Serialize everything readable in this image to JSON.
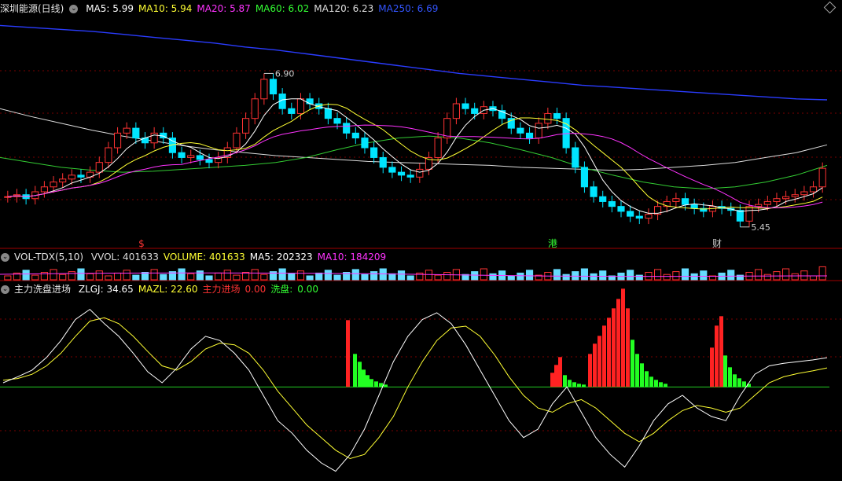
{
  "main": {
    "title": "深圳能源(日线)",
    "ma": [
      {
        "label": "MA5: 5.99",
        "color": "#ffffff"
      },
      {
        "label": "MA10: 5.94",
        "color": "#ffff33"
      },
      {
        "label": "MA20: 5.87",
        "color": "#ff33ff"
      },
      {
        "label": "MA60: 6.02",
        "color": "#33ff33"
      },
      {
        "label": "MA120: 6.23",
        "color": "#dddddd"
      },
      {
        "label": "MA250: 6.69",
        "color": "#3355ff"
      }
    ],
    "annotations": {
      "high": "6.90",
      "low": "5.45"
    },
    "markers": [
      "$",
      "港",
      "财"
    ]
  },
  "volume": {
    "title": "VOL-TDX(5,10)",
    "items": [
      {
        "label": "VVOL: 401633",
        "color": "#dddddd"
      },
      {
        "label": "VOLUME: 401633",
        "color": "#ffff33"
      },
      {
        "label": "MA5: 202323",
        "color": "#ffffff"
      },
      {
        "label": "MA10: 184209",
        "color": "#ff33ff"
      }
    ]
  },
  "indicator": {
    "title": "主力洗盘进场",
    "items": [
      {
        "label": "ZLGJ: 34.65",
        "color": "#ffffff"
      },
      {
        "label": "MAZL: 22.60",
        "color": "#ffff33"
      },
      {
        "label": "主力进场",
        "color": "#ff3333"
      },
      {
        "label": "0.00",
        "color": "#ff3333"
      },
      {
        "label": "洗盘:",
        "color": "#33ff33"
      },
      {
        "label": "0.00",
        "color": "#33ff33"
      }
    ]
  },
  "chart_data": {
    "type": "line",
    "candles_close": [
      5.7,
      5.72,
      5.68,
      5.75,
      5.8,
      5.85,
      5.88,
      5.92,
      5.9,
      5.95,
      6.05,
      6.2,
      6.35,
      6.4,
      6.3,
      6.25,
      6.35,
      6.3,
      6.15,
      6.1,
      6.12,
      6.08,
      6.05,
      6.1,
      6.2,
      6.35,
      6.5,
      6.7,
      6.9,
      6.75,
      6.6,
      6.55,
      6.7,
      6.65,
      6.6,
      6.5,
      6.45,
      6.35,
      6.3,
      6.2,
      6.1,
      6.0,
      5.95,
      5.92,
      5.9,
      5.98,
      6.1,
      6.3,
      6.5,
      6.65,
      6.6,
      6.55,
      6.62,
      6.58,
      6.5,
      6.4,
      6.35,
      6.3,
      6.45,
      6.55,
      6.5,
      6.2,
      6.0,
      5.8,
      5.7,
      5.65,
      5.6,
      5.55,
      5.5,
      5.48,
      5.52,
      5.6,
      5.65,
      5.68,
      5.62,
      5.58,
      5.55,
      5.6,
      5.58,
      5.56,
      5.45,
      5.6,
      5.62,
      5.65,
      5.68,
      5.7,
      5.72,
      5.75,
      5.8,
      5.99
    ],
    "ma250": [
      7.45,
      7.43,
      7.41,
      7.39,
      7.36,
      7.33,
      7.3,
      7.27,
      7.23,
      7.2,
      7.16,
      7.12,
      7.08,
      7.04,
      7.0,
      6.96,
      6.93,
      6.9,
      6.87,
      6.84,
      6.82,
      6.8,
      6.78,
      6.76,
      6.74,
      6.72,
      6.7,
      6.69
    ],
    "ma120": [
      6.6,
      6.52,
      6.45,
      6.38,
      6.32,
      6.27,
      6.22,
      6.18,
      6.15,
      6.12,
      6.1,
      6.08,
      6.06,
      6.05,
      6.04,
      6.03,
      6.02,
      6.0,
      5.99,
      5.98,
      5.97,
      5.98,
      6.0,
      6.02,
      6.05,
      6.1,
      6.15,
      6.23
    ],
    "ma60": [
      6.1,
      6.05,
      6.0,
      5.97,
      5.95,
      5.96,
      5.98,
      6.0,
      6.02,
      6.05,
      6.1,
      6.18,
      6.25,
      6.3,
      6.32,
      6.3,
      6.25,
      6.18,
      6.1,
      6.0,
      5.92,
      5.85,
      5.8,
      5.78,
      5.8,
      5.85,
      5.92,
      6.02
    ],
    "zlgj": [
      5,
      12,
      20,
      35,
      55,
      80,
      92,
      75,
      60,
      40,
      18,
      5,
      22,
      45,
      60,
      55,
      40,
      20,
      -10,
      -40,
      -55,
      -75,
      -90,
      -100,
      -80,
      -50,
      -10,
      30,
      60,
      80,
      88,
      75,
      50,
      20,
      -10,
      -40,
      -60,
      -50,
      -20,
      0,
      -30,
      -60,
      -80,
      -95,
      -70,
      -40,
      -20,
      -10,
      -25,
      -35,
      -40,
      -10,
      15,
      25,
      28,
      30,
      32,
      34.65
    ],
    "mazl": [
      8,
      10,
      15,
      25,
      40,
      60,
      78,
      82,
      75,
      60,
      42,
      25,
      20,
      30,
      45,
      52,
      50,
      40,
      20,
      -5,
      -25,
      -45,
      -60,
      -75,
      -85,
      -80,
      -60,
      -35,
      0,
      30,
      55,
      70,
      72,
      60,
      38,
      12,
      -10,
      -25,
      -30,
      -20,
      -15,
      -25,
      -40,
      -55,
      -65,
      -55,
      -40,
      -28,
      -22,
      -25,
      -30,
      -25,
      -10,
      5,
      12,
      16,
      19,
      22.6
    ],
    "main_ylim": [
      5.3,
      7.55
    ],
    "ind_ylim": [
      -105,
      100
    ]
  }
}
